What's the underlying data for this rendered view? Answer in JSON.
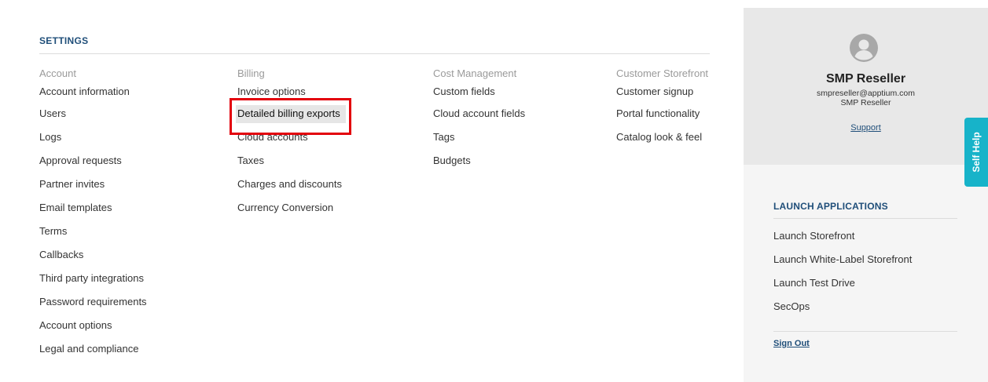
{
  "settings": {
    "title": "SETTINGS",
    "columns": [
      {
        "heading": "Account",
        "items": [
          "Account information",
          "Users",
          "Logs",
          "Approval requests",
          "Partner invites",
          "Email templates",
          "Terms",
          "Callbacks",
          "Third party integrations",
          "Password requirements",
          "Account options",
          "Legal and compliance"
        ]
      },
      {
        "heading": "Billing",
        "items": [
          "Invoice options",
          "Detailed billing exports",
          "Cloud accounts",
          "Taxes",
          "Charges and discounts",
          "Currency Conversion"
        ]
      },
      {
        "heading": "Cost Management",
        "items": [
          "Custom fields",
          "Cloud account fields",
          "Tags",
          "Budgets"
        ]
      },
      {
        "heading": "Customer Storefront",
        "items": [
          "Customer signup",
          "Portal functionality",
          "Catalog look & feel"
        ]
      }
    ]
  },
  "profile": {
    "avatar_icon": "user-circle-icon",
    "name": "SMP Reseller",
    "email": "smpreseller@apptium.com",
    "role": "SMP Reseller",
    "support_label": "Support"
  },
  "launch": {
    "title": "LAUNCH APPLICATIONS",
    "items": [
      "Launch Storefront",
      "Launch White-Label Storefront",
      "Launch Test Drive",
      "SecOps"
    ],
    "signout_label": "Sign Out"
  },
  "self_help": {
    "label": "Self Help",
    "color": "#17b3c9"
  },
  "colors": {
    "accent": "#1f4e79",
    "highlight_box": "#e3000b"
  }
}
